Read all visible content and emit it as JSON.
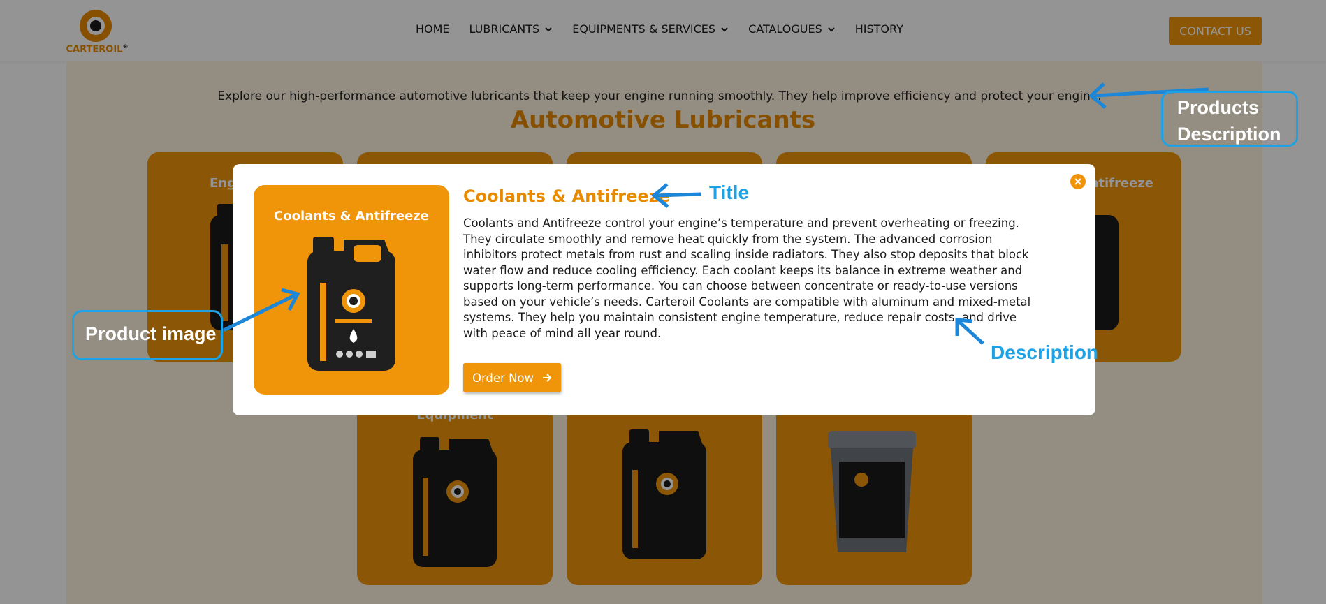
{
  "header": {
    "logo_text": "CARTEROIL",
    "logo_mark": "®",
    "nav": [
      {
        "label": "HOME",
        "has_dropdown": false
      },
      {
        "label": "LUBRICANTS",
        "has_dropdown": true
      },
      {
        "label": "EQUIPMENTS & SERVICES",
        "has_dropdown": true
      },
      {
        "label": "CATALOGUES",
        "has_dropdown": true
      },
      {
        "label": "HISTORY",
        "has_dropdown": false
      }
    ],
    "contact_label": "CONTACT US"
  },
  "page": {
    "intro": "Explore our high-performance automotive lubricants that keep your engine running smoothly. They help improve efficiency and protect your engine.",
    "section_title": "Automotive Lubricants",
    "cards_row1": [
      {
        "title": "Eng"
      },
      {
        "title": ""
      },
      {
        "title": ""
      },
      {
        "title": ""
      },
      {
        "title": "ntifreeze"
      }
    ],
    "cards_row2": [
      {
        "title": "Equipment"
      },
      {
        "title": ""
      },
      {
        "title": ""
      }
    ]
  },
  "modal": {
    "image_title": "Coolants & Antifreeze",
    "title": "Coolants & Antifreeze",
    "description": "Coolants and Antifreeze control your engine’s temperature and prevent overheating or freezing. They circulate smoothly and remove heat quickly from the system. The advanced corrosion inhibitors protect metals from rust and scaling inside radiators. They also stop deposits that block water flow and reduce cooling efficiency. Each coolant keeps its balance in extreme weather and supports long-term performance. You can choose between concentrate or ready-to-use versions based on your vehicle’s needs. Carteroil Coolants are compatible with aluminum and mixed-metal systems. They help you maintain consistent engine temperature, reduce repair costs, and drive with peace of mind all year round.",
    "order_label": "Order Now",
    "close_icon": "close-icon"
  },
  "annotations": {
    "products_description": "Products Description",
    "product_image": "Product image",
    "title": "Title",
    "description": "Description",
    "color": "#1ea2e6"
  },
  "colors": {
    "accent": "#f0940a",
    "title_orange": "#e78a00",
    "panel_bg": "#fff4e0"
  }
}
